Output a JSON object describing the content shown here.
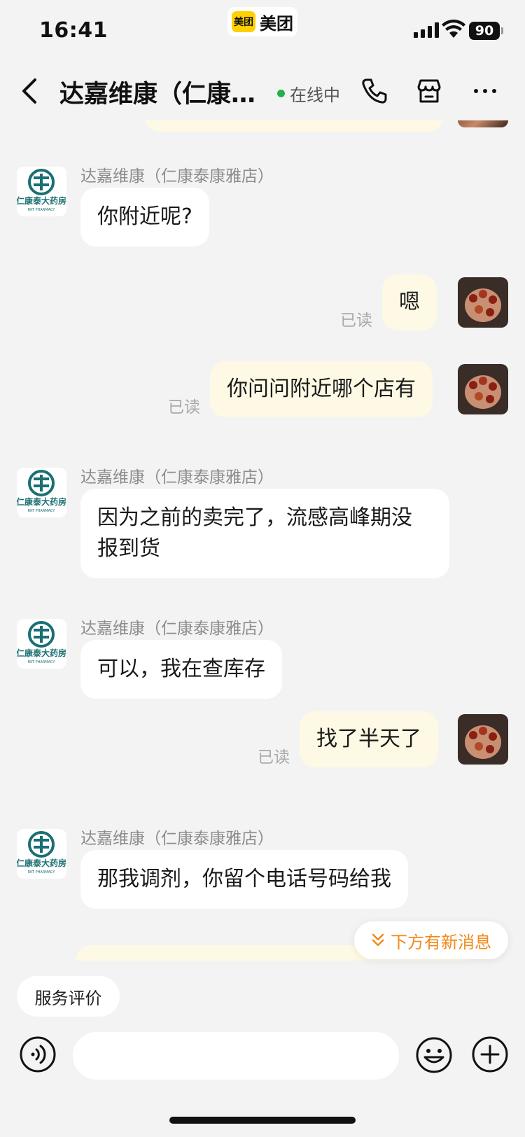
{
  "status_bar": {
    "time": "16:41",
    "app_badge_logo": "美团",
    "app_badge_text": "美团",
    "battery": "90"
  },
  "header": {
    "title": "达嘉维康（仁康…",
    "status": "在线中",
    "icons": [
      "back-icon",
      "phone-icon",
      "store-icon",
      "more-icon"
    ]
  },
  "messages": [
    {
      "side": "right",
      "read": "已读",
      "text": ""
    },
    {
      "side": "left",
      "sender": "达嘉维康（仁康泰康雅店）",
      "text": "你附近呢?"
    },
    {
      "side": "right",
      "read": "已读",
      "text": "嗯"
    },
    {
      "side": "right",
      "read": "已读",
      "text": "你问问附近哪个店有"
    },
    {
      "side": "left",
      "sender": "达嘉维康（仁康泰康雅店）",
      "text": "因为之前的卖完了，流感高峰期没报到货",
      "line1": "因为之前的卖完了，流感高峰期没",
      "line2": "报到货"
    },
    {
      "side": "left",
      "sender": "达嘉维康（仁康泰康雅店）",
      "text": "可以，我在查库存"
    },
    {
      "side": "right",
      "read": "已读",
      "text": "找了半天了"
    },
    {
      "side": "left",
      "sender": "达嘉维康（仁康泰康雅店）",
      "text": "那我调剂，你留个电话号码给我"
    }
  ],
  "shop_logo": {
    "name": "仁康泰大药房",
    "sub": "RKT PHARMACY",
    "color": "#1a6f73"
  },
  "new_message_button": "下方有新消息",
  "rating_button": "服务评价",
  "input": {
    "value": "",
    "placeholder": ""
  },
  "colors": {
    "accent": "#f18a1b",
    "user_bubble": "#fef9e4",
    "online": "#22b14c"
  }
}
